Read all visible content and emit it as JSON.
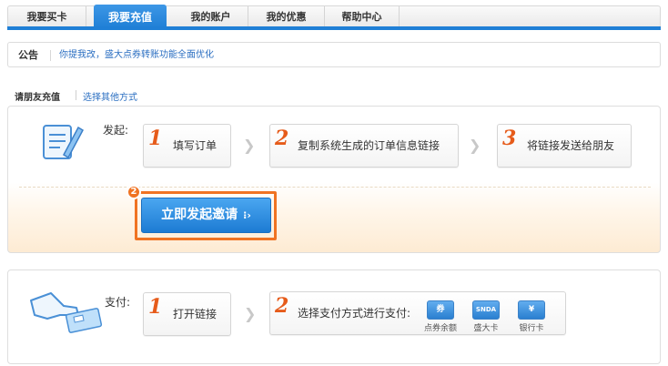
{
  "nav": {
    "tabs": [
      "我要买卡",
      "我要充值",
      "我的账户",
      "我的优惠",
      "帮助中心"
    ],
    "active_index": 1
  },
  "notice": {
    "label": "公告",
    "text": "你提我改，盛大点券转账功能全面优化"
  },
  "section": {
    "title": "请朋友充值",
    "alt_link": "选择其他方式"
  },
  "invite": {
    "label": "发起:",
    "steps": [
      {
        "num": "1",
        "text": "填写订单"
      },
      {
        "num": "2",
        "text": "复制系统生成的订单信息链接"
      },
      {
        "num": "3",
        "text": "将链接发送给朋友"
      }
    ],
    "badge": "2",
    "cta": "立即发起邀请",
    "cta_arrow": "⁝›"
  },
  "pay": {
    "label": "支付:",
    "steps": [
      {
        "num": "1",
        "text": "打开链接"
      },
      {
        "num": "2",
        "text": "选择支付方式进行支付:"
      }
    ],
    "methods": [
      {
        "icon_text": "券",
        "label": "点券余额"
      },
      {
        "icon_text": "SNDA",
        "label": "盛大卡"
      },
      {
        "icon_text": "¥",
        "label": "银行卡"
      }
    ]
  },
  "colors": {
    "brand_blue": "#1f7fd6",
    "accent_orange": "#f07322",
    "link_blue": "#2a6ec1"
  }
}
